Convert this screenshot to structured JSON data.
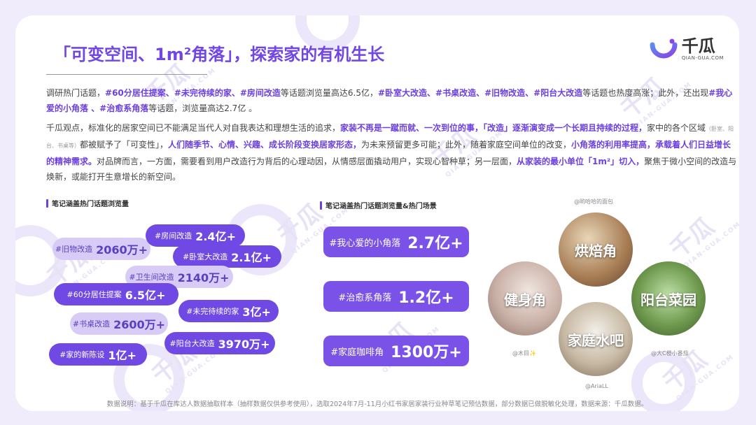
{
  "title": "「可变空间、1m²角落」，探索家的有机生长",
  "logo": {
    "cn": "千瓜",
    "en": "QIAN-GUA.COM"
  },
  "watermark": {
    "cn": "千瓜",
    "en": "QIAN-GUA.COM"
  },
  "p1": [
    {
      "t": "调研热门话题，",
      "h": false
    },
    {
      "t": "#60分居住提案、#未完待续的家、#房间改造",
      "h": true
    },
    {
      "t": "等话题浏览量高达6.5亿，",
      "h": false
    },
    {
      "t": "#卧室大改造、#书桌改造、#旧物改造、#阳台大改造",
      "h": true
    },
    {
      "t": "等话题也热度高涨；此外，还出现",
      "h": false
    },
    {
      "t": "#我心爱的小角落 、#治愈系角落",
      "h": true
    },
    {
      "t": "等话题，浏览量高达2.7亿 。",
      "h": false
    }
  ],
  "p2": [
    {
      "t": "千瓜观点，标准化的居家空间已不能满足当代人对自我表达和理想生活的追求，",
      "h": false
    },
    {
      "t": "家装不再是一蹴而就、一次到位的事，「改造」逐渐演变成一个长期且持续的过程，",
      "h": true
    },
    {
      "t": "家中的各个区域",
      "h": false
    },
    {
      "t": "（卧室、阳台、书桌等）",
      "h": false,
      "s": true
    },
    {
      "t": "都被赋予了「可变性」，",
      "h": false
    },
    {
      "t": "人们随季节、心情、兴趣、成长阶段变换居家形态，",
      "h": true
    },
    {
      "t": "为未来预留更多可能；此外，随着家庭空间单位的改变，",
      "h": false
    },
    {
      "t": "小角落的利用率提高，承载着人们日益增长的精神需求。",
      "h": true
    },
    {
      "t": "对品牌而言，一方面，需要看到用户改造行为背后的心理动因，从情感层面撬动用户，实现心智种草；另一层面，",
      "h": false
    },
    {
      "t": "从家装的最小单位「1m²」切入，",
      "h": true
    },
    {
      "t": "聚焦于微小空间的改造与焕新，或能打开生意增长的新空间。",
      "h": false
    }
  ],
  "section_left": "笔记涵盖热门话题浏览量",
  "section_mid": "笔记涵盖热门话题浏览量&热门场景",
  "pills": [
    {
      "tag": "#旧物改造",
      "value": "2060万+",
      "style": "light"
    },
    {
      "tag": "#房间改造",
      "value": "2.4亿+",
      "style": "dark"
    },
    {
      "tag": "#卧室大改造",
      "value": "2.1亿+",
      "style": "dark"
    },
    {
      "tag": "#卫生间改造",
      "value": "2140万+",
      "style": "light"
    },
    {
      "tag": "#60分居住提案",
      "value": "6.5亿+",
      "style": "dark"
    },
    {
      "tag": "#未完待续的家",
      "value": "3亿+",
      "style": "dark"
    },
    {
      "tag": "#书桌改造",
      "value": "2600万+",
      "style": "light"
    },
    {
      "tag": "#阳台大改造",
      "value": "3970万+",
      "style": "dark"
    },
    {
      "tag": "#家的新陈设",
      "value": "1亿+",
      "style": "dark"
    }
  ],
  "bigpills": [
    {
      "tag": "#我心爱的小角落",
      "value": "2.7亿+"
    },
    {
      "tag": "#治愈系角落",
      "value": "1.2亿+"
    },
    {
      "tag": "#家庭咖啡角",
      "value": "1300万+"
    }
  ],
  "scenes": [
    {
      "label": "烘焙角",
      "credit": "@哟哈哈的面包"
    },
    {
      "label": "健身角",
      "credit": "@木目✨"
    },
    {
      "label": "阳台菜园",
      "credit": "@大C橙小番茄"
    },
    {
      "label": "家庭水吧",
      "credit": "@AriaLL"
    }
  ],
  "footer": "数据说明：基于千瓜在库达人数据抽取样本（抽样数据仅供参考使用），选取2024年7月-11月小红书家居家装行业种草笔记预估数据，部分数据已做脱敏化处理，数据来源：千瓜数据。",
  "colors": {
    "accent": "#7048e3",
    "light": "#d8ccf7",
    "highlight": "#6b3fe0"
  }
}
